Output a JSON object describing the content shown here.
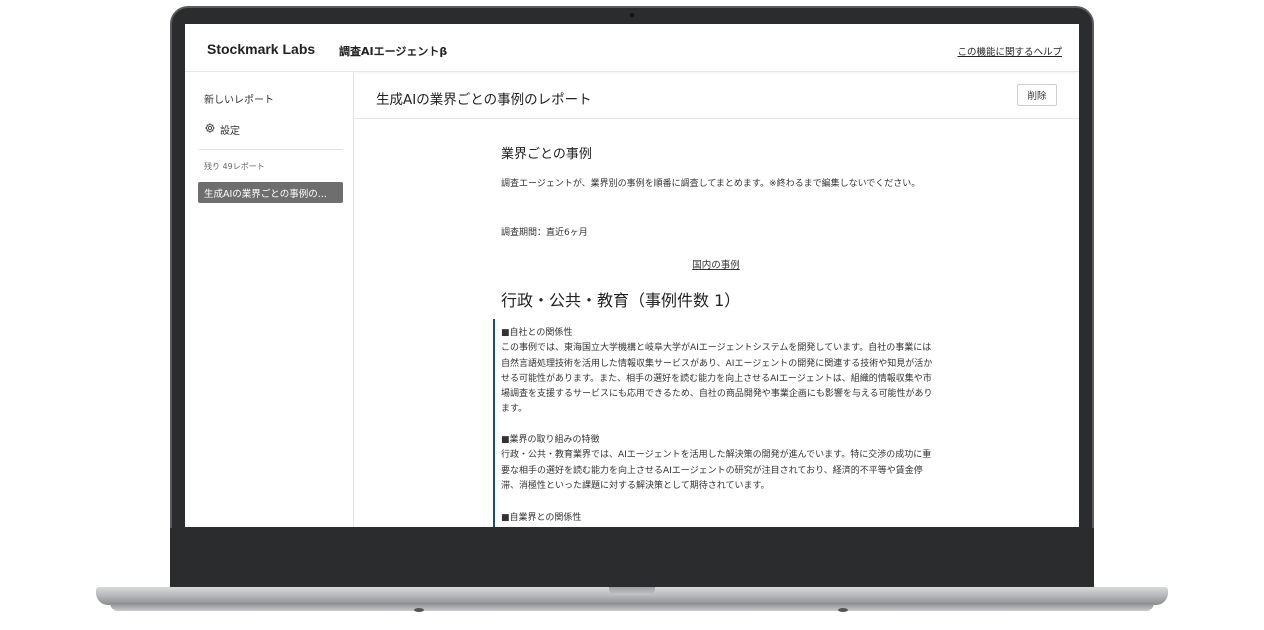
{
  "header": {
    "brand": "Stockmark Labs",
    "product": "調査AIエージェントβ",
    "help_link": "この機能に関するヘルプ"
  },
  "sidebar": {
    "new_report": "新しいレポート",
    "settings": "設定",
    "remaining": "残り 49レポート",
    "reports": [
      {
        "label": "生成AIの業界ごとの事例の..."
      }
    ]
  },
  "main": {
    "title": "生成AIの業界ごとの事例のレポート",
    "delete_label": "削除",
    "section_title": "業界ごとの事例",
    "intro": "調査エージェントが、業界別の事例を順番に調査してまとめます。※終わるまで編集しないでください。",
    "period": "調査期間：直近6ヶ月",
    "domestic_link": "国内の事例",
    "category_title": "行政・公共・教育（事例件数 1）",
    "blocks": [
      {
        "heading": "■自社との関係性",
        "body": "この事例では、東海国立大学機構と岐阜大学がAIエージェントシステムを開発しています。自社の事業には自然言語処理技術を活用した情報収集サービスがあり、AIエージェントの開発に関連する技術や知見が活かせる可能性があります。また、相手の選好を読む能力を向上させるAIエージェントは、組織的情報収集や市場調査を支援するサービスにも応用できるため、自社の商品開発や事業企画にも影響を与える可能性があります。"
      },
      {
        "heading": "■業界の取り組みの特徴",
        "body": "行政・公共・教育業界では、AIエージェントを活用した解決策の開発が進んでいます。特に交渉の成功に重要な相手の選好を読む能力を向上させるAIエージェントの研究が注目されており、経済的不平等や賃金停滞、消極性といった課題に対する解決策として期待されています。"
      },
      {
        "heading": "■自業界との関係性",
        "body": ""
      }
    ]
  },
  "colors": {
    "bezel": "#2b2c2e",
    "active_report_bg": "#6e6e6e",
    "case_bar": "#1f4e6b"
  }
}
